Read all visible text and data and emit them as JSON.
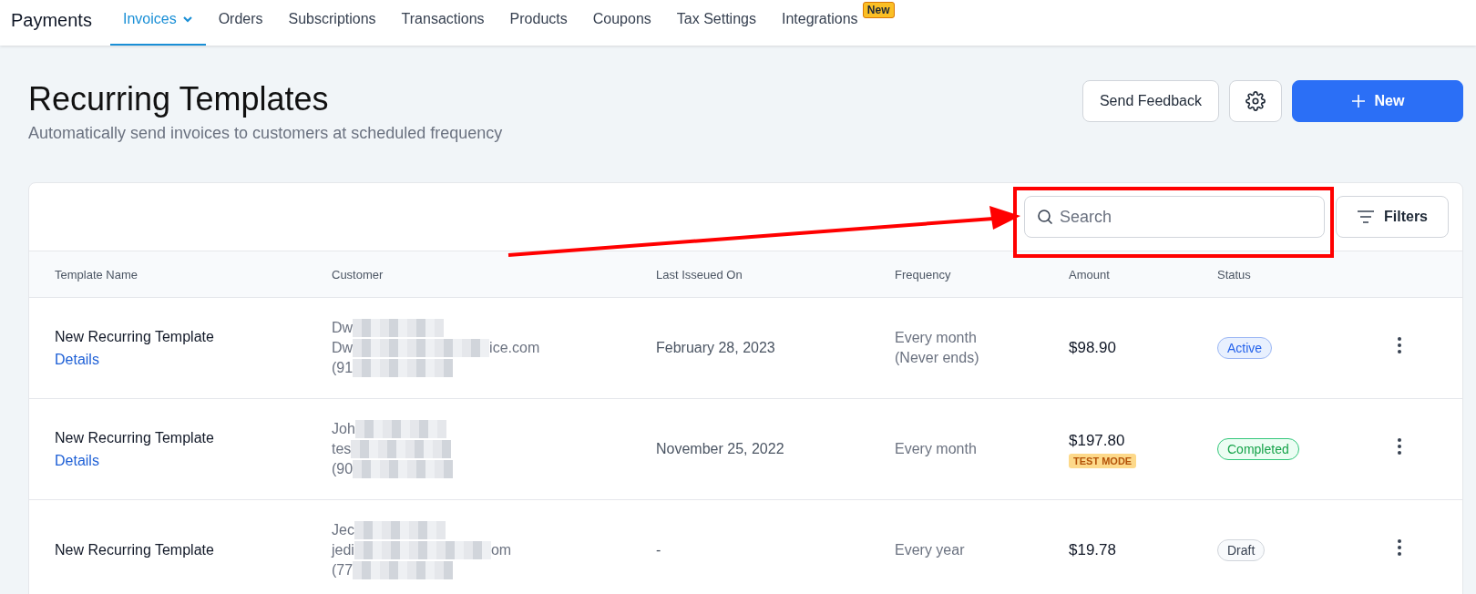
{
  "app_title": "Payments",
  "nav_tabs": [
    {
      "label": "Invoices",
      "selected": true,
      "has_dropdown": true
    },
    {
      "label": "Orders",
      "selected": false
    },
    {
      "label": "Subscriptions",
      "selected": false
    },
    {
      "label": "Transactions",
      "selected": false
    },
    {
      "label": "Products",
      "selected": false
    },
    {
      "label": "Coupons",
      "selected": false
    },
    {
      "label": "Tax Settings",
      "selected": false
    },
    {
      "label": "Integrations",
      "selected": false,
      "badge": "New"
    }
  ],
  "page": {
    "title": "Recurring Templates",
    "subtitle": "Automatically send invoices to customers at scheduled frequency"
  },
  "actions": {
    "feedback": "Send Feedback",
    "new": "New"
  },
  "search": {
    "placeholder": "Search"
  },
  "filters": "Filters",
  "table": {
    "columns": [
      "Template Name",
      "Customer",
      "Last Isseued On",
      "Frequency",
      "Amount",
      "Status"
    ],
    "rows": [
      {
        "name": "New Recurring Template",
        "link": "Details",
        "customer": [
          {
            "text": "Dw"
          },
          {
            "text": "Dw",
            "tail": "ice.com"
          },
          {
            "text": "(91"
          }
        ],
        "last_issued": "February 28, 2023",
        "frequency": [
          "Every month",
          "(Never ends)"
        ],
        "amount": "$98.90",
        "status": {
          "label": "Active",
          "kind": "active"
        }
      },
      {
        "name": "New Recurring Template",
        "link": "Details",
        "customer": [
          {
            "text": "Joh"
          },
          {
            "text": "tes"
          },
          {
            "text": "(90"
          }
        ],
        "last_issued": "November 25, 2022",
        "frequency": [
          "Every month"
        ],
        "amount": "$197.80",
        "amount_badge": "TEST MODE",
        "status": {
          "label": "Completed",
          "kind": "completed"
        }
      },
      {
        "name": "New Recurring Template",
        "customer": [
          {
            "text": "Jec"
          },
          {
            "text": "jedi",
            "tail": "om"
          },
          {
            "text": "(77"
          }
        ],
        "last_issued": "-",
        "frequency": [
          "Every year"
        ],
        "amount": "$19.78",
        "status": {
          "label": "Draft",
          "kind": "draft"
        }
      }
    ]
  },
  "annotation": {
    "highlight": true,
    "arrow": true
  }
}
